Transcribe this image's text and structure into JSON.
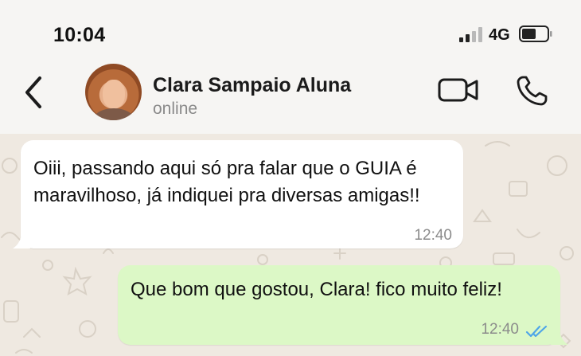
{
  "status_bar": {
    "time": "10:04",
    "network": "4G"
  },
  "header": {
    "contact_name": "Clara Sampaio Aluna",
    "contact_status": "online",
    "icons": {
      "back": "chevron-left-icon",
      "video": "video-camera-icon",
      "call": "phone-icon"
    }
  },
  "messages": [
    {
      "direction": "incoming",
      "text": "Oiii, passando aqui só pra falar que o GUIA é maravilhoso, já indiquei pra diversas amigas!!",
      "time": "12:40"
    },
    {
      "direction": "outgoing",
      "text": "Que bom que gostou, Clara! fico muito feliz!",
      "time": "12:40",
      "read_receipt": "double-check-icon"
    }
  ],
  "colors": {
    "incoming_bubble": "#ffffff",
    "outgoing_bubble": "#dcf8c6",
    "chat_background": "#efe9e1",
    "read_ticks": "#4fa6e8"
  }
}
